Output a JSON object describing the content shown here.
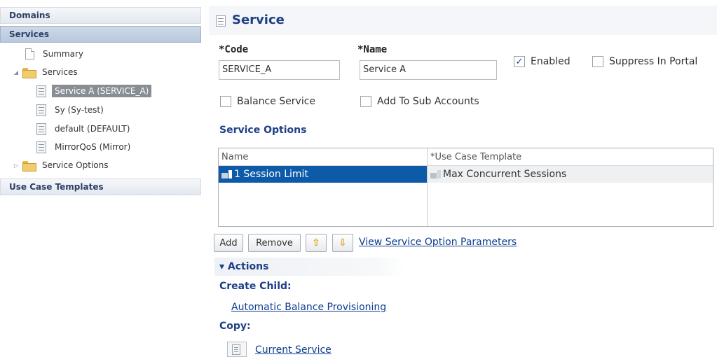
{
  "nav": {
    "domains_label": "Domains",
    "services_label": "Services",
    "use_case_templates_label": "Use Case Templates",
    "tree": {
      "summary": "Summary",
      "services_folder": "Services",
      "items": [
        "Service A (SERVICE_A)",
        "Sy (Sy-test)",
        "default (DEFAULT)",
        "MirrorQoS (Mirror)"
      ],
      "service_options_folder": "Service Options"
    }
  },
  "page": {
    "title": "Service"
  },
  "form": {
    "code_label": "*Code",
    "code_value": "SERVICE_A",
    "name_label": "*Name",
    "name_value": "Service A",
    "enabled_label": "Enabled",
    "enabled_checked": "✓",
    "suppress_label": "Suppress In Portal",
    "balance_label": "Balance Service",
    "add_sub_label": "Add To Sub Accounts"
  },
  "service_options": {
    "title": "Service Options",
    "col_name": "Name",
    "col_template": "*Use Case Template",
    "rows": [
      {
        "name": "1 Session Limit",
        "template": "Max Concurrent Sessions"
      }
    ]
  },
  "buttons": {
    "add": "Add",
    "remove": "Remove",
    "up": "⇧",
    "down": "⇩",
    "view_params": "View Service Option Parameters"
  },
  "actions": {
    "title": "Actions",
    "toggle_icon": "▾",
    "create_child": "Create Child:",
    "auto_balance": "Automatic Balance Provisioning",
    "copy": "Copy:",
    "current_service": "Current Service"
  }
}
